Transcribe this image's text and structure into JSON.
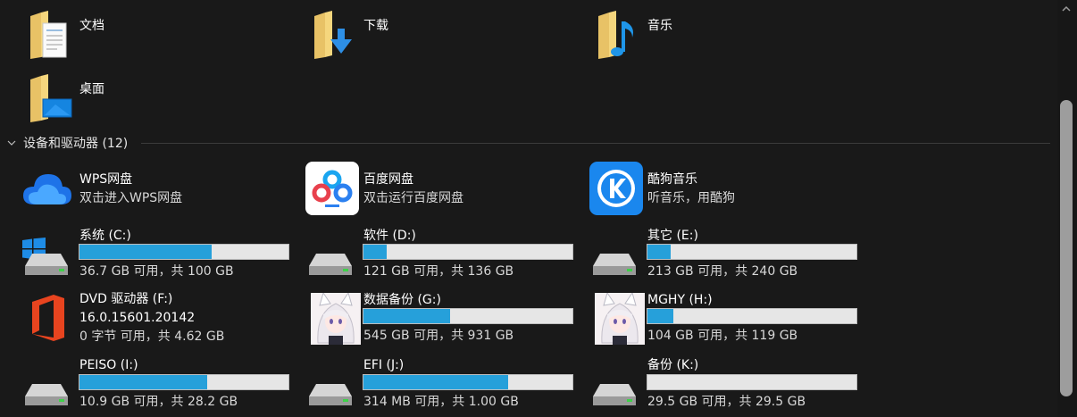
{
  "folders": [
    {
      "name": "文档"
    },
    {
      "name": "下载"
    },
    {
      "name": "音乐"
    },
    {
      "name": "桌面"
    }
  ],
  "section": {
    "title": "设备和驱动器 (12)"
  },
  "apps": [
    {
      "name": "WPS网盘",
      "desc": "双击进入WPS网盘"
    },
    {
      "name": "百度网盘",
      "desc": "双击运行百度网盘"
    },
    {
      "name": "酷狗音乐",
      "desc": "听音乐，用酷狗"
    }
  ],
  "drives": [
    {
      "name": "系统 (C:)",
      "space": "36.7 GB 可用，共 100 GB",
      "used_fraction": 0.633,
      "bar_color": "#26a0da"
    },
    {
      "name": "软件 (D:)",
      "space": "121 GB 可用，共 136 GB",
      "used_fraction": 0.11,
      "bar_color": "#26a0da"
    },
    {
      "name": "其它 (E:)",
      "space": "213 GB 可用，共 240 GB",
      "used_fraction": 0.113,
      "bar_color": "#26a0da"
    },
    {
      "name": "数据备份 (G:)",
      "space": "545 GB 可用，共 931 GB",
      "used_fraction": 0.415,
      "bar_color": "#26a0da"
    },
    {
      "name": "MGHY (H:)",
      "space": "104 GB 可用，共 119 GB",
      "used_fraction": 0.126,
      "bar_color": "#26a0da"
    },
    {
      "name": "PEISO (I:)",
      "space": "10.9 GB 可用，共 28.2 GB",
      "used_fraction": 0.613,
      "bar_color": "#26a0da"
    },
    {
      "name": "EFI (J:)",
      "space": "314 MB 可用，共 1.00 GB",
      "used_fraction": 0.693,
      "bar_color": "#26a0da"
    },
    {
      "name": "备份 (K:)",
      "space": "29.5 GB 可用，共 29.5 GB",
      "used_fraction": 0.0,
      "bar_color": "#26a0da"
    }
  ],
  "dvd": {
    "name": "DVD 驱动器 (F:)",
    "version": "16.0.15601.20142",
    "space": "0 字节 可用，共 4.62 GB"
  },
  "icons": {
    "folder": "folder-icon",
    "drive": "hard-drive-icon",
    "windows": "windows-logo-icon",
    "office": "office-logo-icon",
    "wps": "cloud-icon",
    "baidu": "baidu-netdisk-icon",
    "kugou": "kugou-icon",
    "avatar": "anime-avatar-icon"
  }
}
